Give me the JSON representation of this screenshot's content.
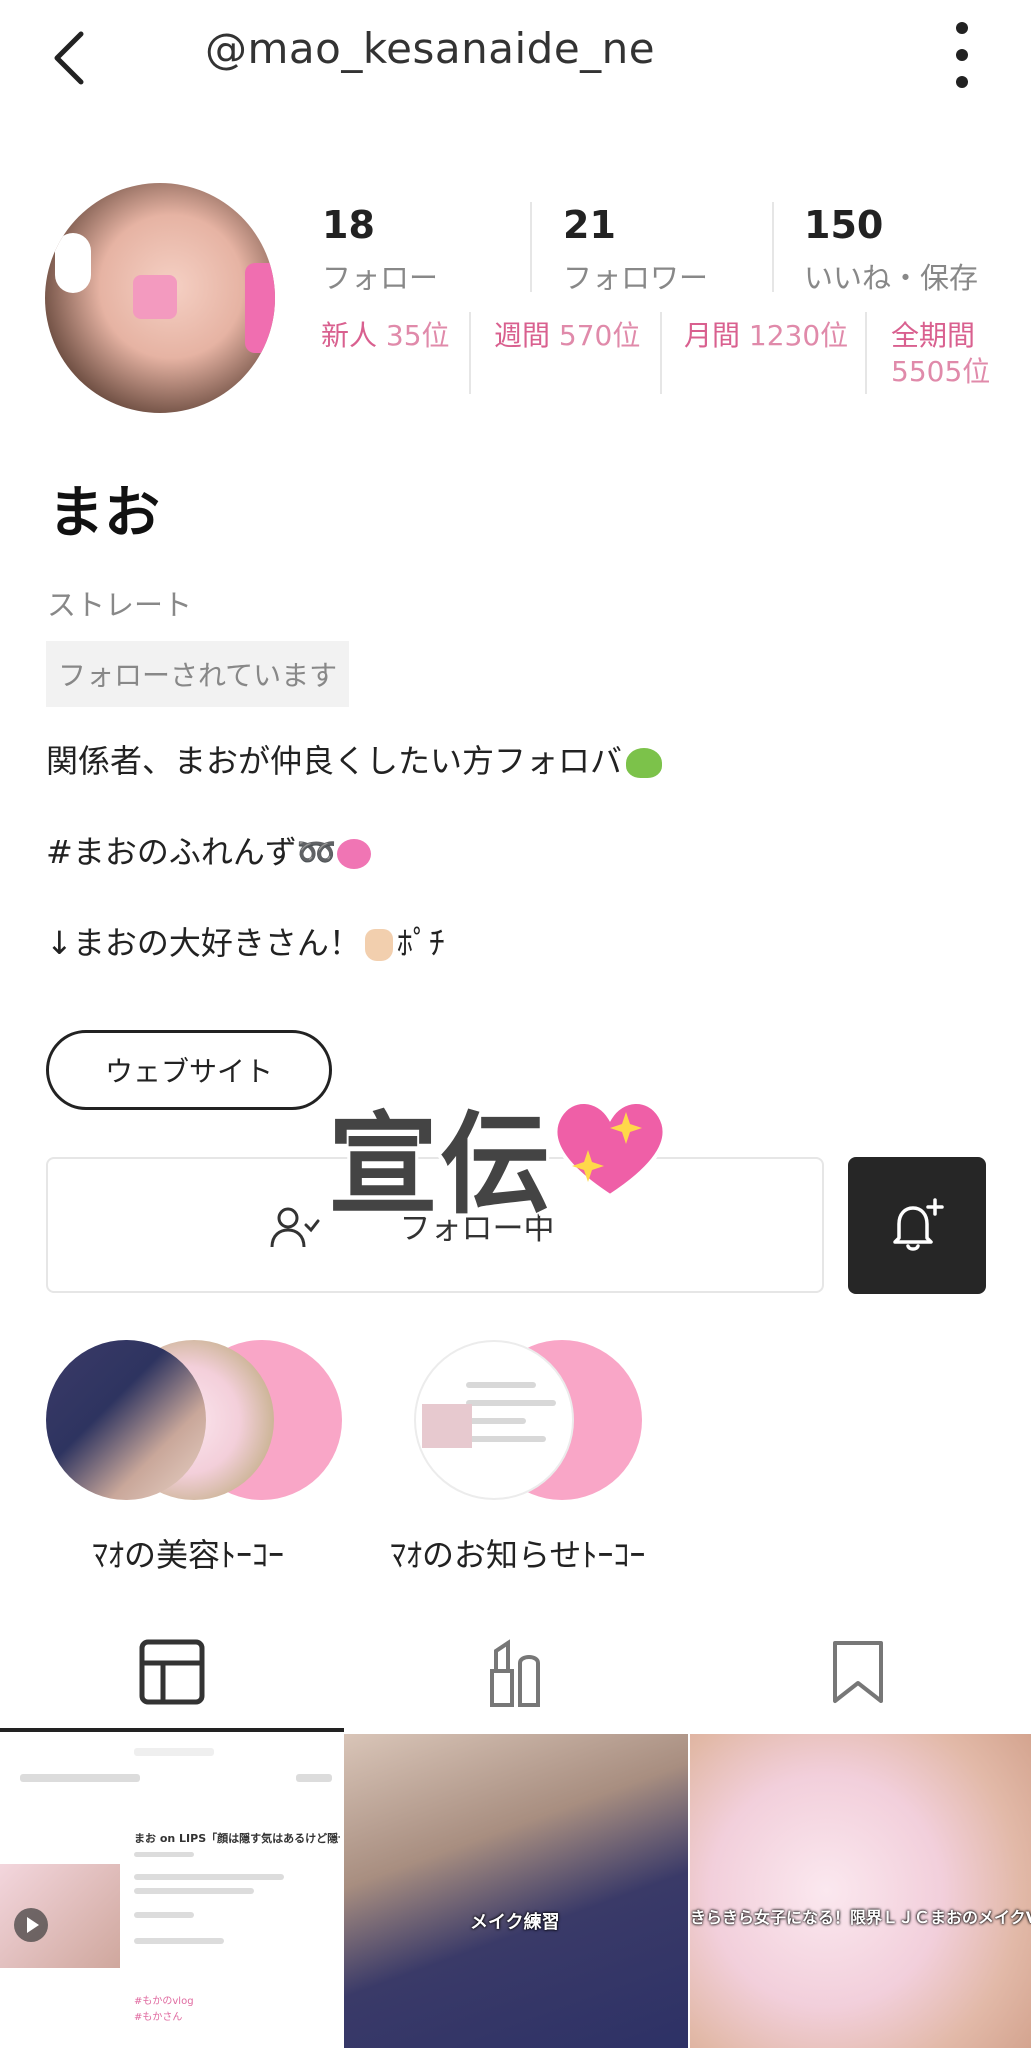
{
  "header": {
    "username": "@mao_kesanaide_ne"
  },
  "profile": {
    "stats": [
      {
        "value": "18",
        "label": "フォロー"
      },
      {
        "value": "21",
        "label": "フォロワー"
      },
      {
        "value": "150",
        "label": "いいね・保存"
      }
    ],
    "ranks": [
      {
        "label": "新人",
        "value": "35位"
      },
      {
        "label": "週間",
        "value": "570位"
      },
      {
        "label": "月間",
        "value": "1230位"
      },
      {
        "label": "全期間",
        "value": "5505位"
      }
    ],
    "display_name": "まお",
    "skin_type": "ストレート",
    "follows_you": "フォローされています",
    "bio": [
      "関係者、まおが仲良くしたい方フォロバ",
      "#まおのふれんず➿",
      "↓まおの大好きさん！",
      "ﾎﾟﾁ"
    ],
    "website_label": "ウェブサイト",
    "promo_overlay": "宣伝",
    "follow_label": "フォロー中"
  },
  "collections": [
    {
      "title": "ﾏｵの美容ﾄｰｺｰ"
    },
    {
      "title": "ﾏｵのお知らせﾄｰｺｰ"
    }
  ],
  "tabs": [
    {
      "icon": "grid-icon"
    },
    {
      "icon": "cosmetics-icon"
    },
    {
      "icon": "bookmark-icon"
    }
  ],
  "posts": {
    "post1_title": "まお on LIPS「顔は隠す気はあるけど隠せなかったデス笑",
    "post1_tag1": "#もかのvlog",
    "post1_tag2": "#もかさん",
    "post2_caption": "メイク練習",
    "post3_caption": "きらきら女子になる！限界ＬＪＣまおのメイクVLOG"
  },
  "colors": {
    "accent": "#d9608f",
    "bell_bg": "#262626",
    "collection_pink": "#f9a6c7"
  }
}
